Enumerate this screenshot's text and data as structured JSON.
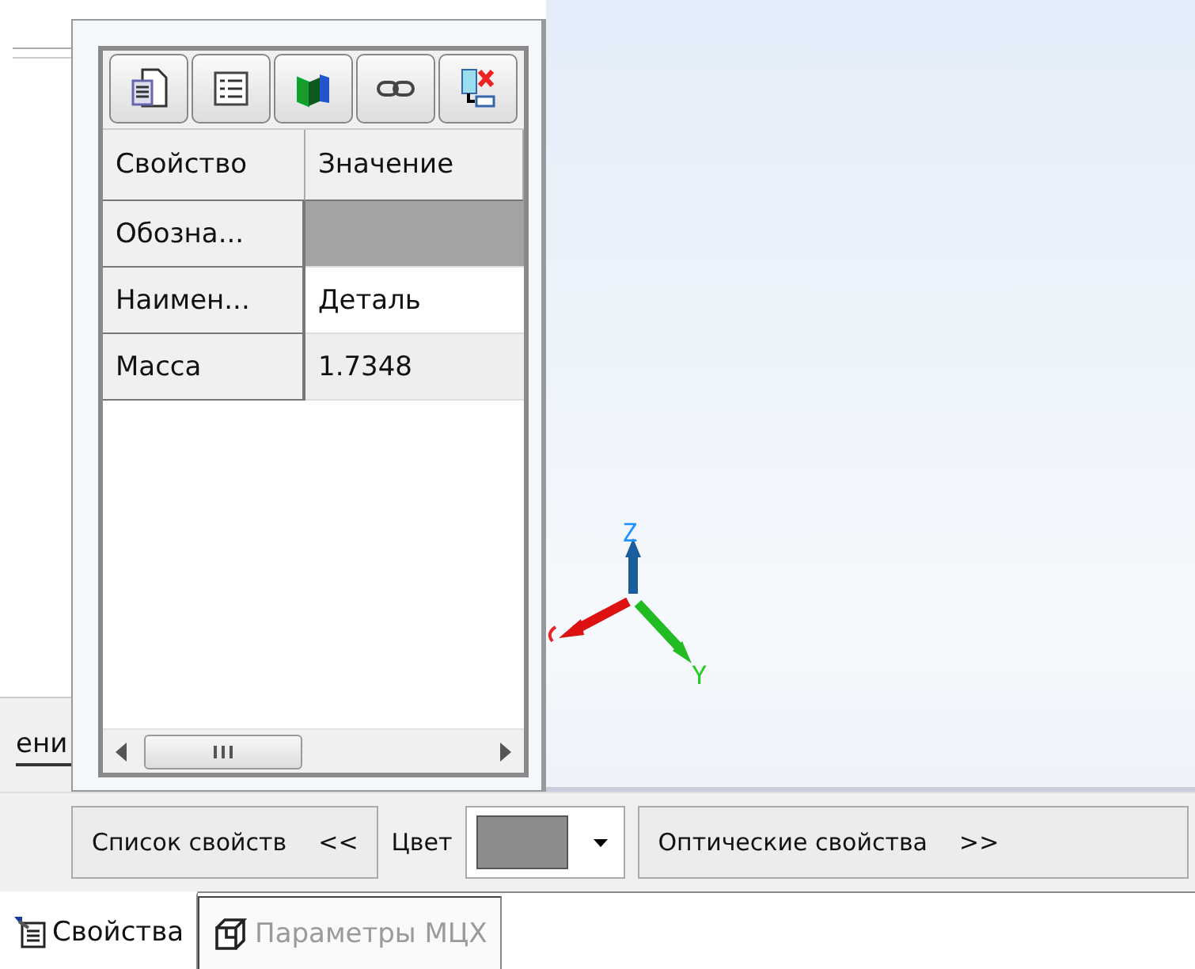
{
  "left_panel": {
    "tab_fragment": "ени"
  },
  "properties_panel": {
    "table": {
      "columns": [
        "Свойство",
        "Значение"
      ],
      "rows": [
        {
          "property": "Обозна...",
          "kind": "locked"
        },
        {
          "property": "Наимен...",
          "value": "Деталь",
          "kind": "editable"
        },
        {
          "property": "Масса",
          "value": "1.7348",
          "kind": "readonly"
        }
      ]
    }
  },
  "viewport": {
    "axis_labels": [
      {
        "text": "Z",
        "color": "#1e90ff"
      },
      {
        "text": "Y",
        "color": "#22cc22"
      }
    ]
  },
  "bottom_bar": {
    "properties_button": {
      "label": "Список свойств",
      "arrows": "<<"
    },
    "color_label": "Цвет",
    "color_swatch": {
      "color": "#8c8c8c"
    },
    "optical_button": {
      "label": "Оптические свойства",
      "arrows": ">>"
    }
  },
  "tabs": [
    {
      "label": "Свойства",
      "selected": true,
      "disabled": false
    },
    {
      "label": "Параметры МЦХ",
      "selected": false,
      "disabled": true
    }
  ]
}
